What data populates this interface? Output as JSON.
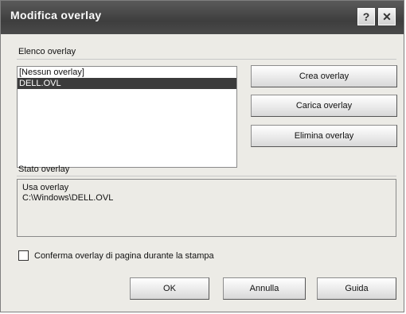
{
  "window": {
    "title": "Modifica overlay",
    "help_glyph": "?",
    "close_glyph": "✕"
  },
  "list_section": {
    "label": "Elenco overlay",
    "items": [
      {
        "label": "[Nessun overlay]",
        "selected": false
      },
      {
        "label": "DELL.OVL",
        "selected": true
      }
    ]
  },
  "buttons": {
    "create": "Crea overlay",
    "load": "Carica overlay",
    "delete": "Elimina overlay",
    "ok": "OK",
    "cancel": "Annulla",
    "help": "Guida"
  },
  "status_section": {
    "label": "Stato overlay",
    "line1": "Usa overlay",
    "line2": "C:\\Windows\\DELL.OVL"
  },
  "confirm_checkbox": {
    "label": "Conferma overlay di pagina durante la stampa",
    "checked": false
  }
}
